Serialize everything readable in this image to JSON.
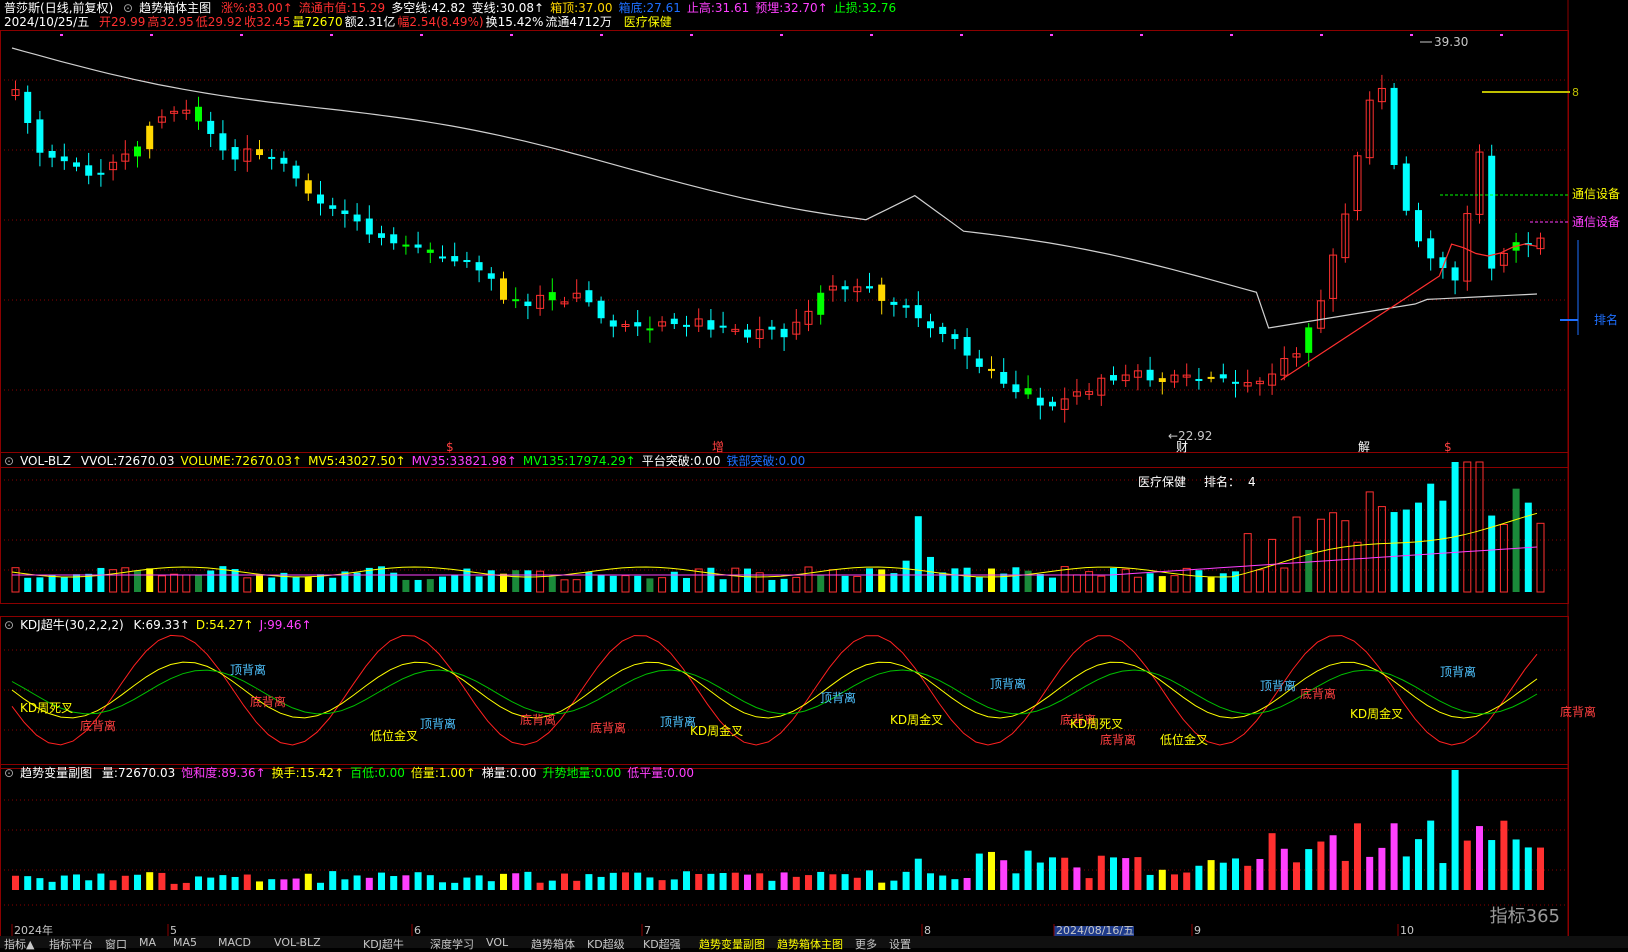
{
  "header": {
    "stock_name": "普莎斯",
    "adjust": "(日线,前复权)",
    "indicator": "趋势箱体主图",
    "main_fields": [
      {
        "label": "涨%:",
        "value": "83.00",
        "color": "#ff3030",
        "arrow": "↑"
      },
      {
        "label": "流通市值:",
        "value": "15.29",
        "color": "#ff3030",
        "arrow": ""
      },
      {
        "label": "多空线:",
        "value": "42.82",
        "color": "#ffffff",
        "arrow": ""
      },
      {
        "label": "变线:",
        "value": "30.08",
        "color": "#ffffff",
        "arrow": "↑"
      },
      {
        "label": "箱顶:",
        "value": "37.00",
        "color": "#ffd700",
        "arrow": ""
      },
      {
        "label": "箱底:",
        "value": "27.61",
        "color": "#1e6fff",
        "arrow": ""
      },
      {
        "label": "止高:",
        "value": "31.61",
        "color": "#ff40ff",
        "arrow": ""
      },
      {
        "label": "预埋:",
        "value": "32.70",
        "color": "#ff40ff",
        "arrow": "↑"
      },
      {
        "label": "止损:",
        "value": "32.76",
        "color": "#00ff00",
        "arrow": ""
      }
    ],
    "date": "2024/10/25/五",
    "quote": [
      {
        "label": "开",
        "value": "29.99",
        "color": "#ff3030"
      },
      {
        "label": "高",
        "value": "32.95",
        "color": "#ff3030"
      },
      {
        "label": "低",
        "value": "29.92",
        "color": "#ff3030"
      },
      {
        "label": "收",
        "value": "32.45",
        "color": "#ff3030"
      },
      {
        "label": "量",
        "value": "72670",
        "color": "#ffff00"
      },
      {
        "label": "额",
        "value": "2.31亿",
        "color": "#ffffff"
      },
      {
        "label": "幅",
        "value": "2.54(8.49%)",
        "color": "#ff3030"
      },
      {
        "label": "换",
        "value": "15.42%",
        "color": "#ffffff"
      },
      {
        "label": "流通",
        "value": "4712万",
        "color": "#ffffff"
      }
    ],
    "sector": "医疗保健"
  },
  "price_labels": {
    "high": "39.30",
    "low": "22.92",
    "right1": "通信设备",
    "right2": "通信设备",
    "right3": "排名",
    "right0": "8",
    "markers": [
      "$",
      "增",
      "财",
      "解",
      "$"
    ]
  },
  "vol_panel": {
    "title": "VOL-BLZ",
    "fields": [
      {
        "label": "VVOL:",
        "value": "72670.03",
        "color": "#ffffff"
      },
      {
        "label": "VOLUME:",
        "value": "72670.03",
        "color": "#ffff00",
        "arrow": "↑"
      },
      {
        "label": "MV5:",
        "value": "43027.50",
        "color": "#ffff00",
        "arrow": "↑"
      },
      {
        "label": "MV35:",
        "value": "33821.98",
        "color": "#ff40ff",
        "arrow": "↑"
      },
      {
        "label": "MV135:",
        "value": "17974.29",
        "color": "#00ff00",
        "arrow": "↑"
      },
      {
        "label": "平台突破:",
        "value": "0.00",
        "color": "#ffffff",
        "arrow": ""
      },
      {
        "label": "铁部突破:",
        "value": "0.00",
        "color": "#1e6fff",
        "arrow": ""
      }
    ],
    "sector_label": "医疗保健",
    "rank_label": "排名：",
    "rank_value": "4"
  },
  "kdj_panel": {
    "title": "KDJ超牛(30,2,2,2)",
    "fields": [
      {
        "label": "K:",
        "value": "69.33",
        "color": "#ffffff",
        "arrow": "↑"
      },
      {
        "label": "D:",
        "value": "54.27",
        "color": "#ffff00",
        "arrow": "↑"
      },
      {
        "label": "J:",
        "value": "99.46",
        "color": "#ff40ff",
        "arrow": "↑"
      }
    ],
    "labels": [
      "顶背离",
      "底背离",
      "KD周死叉",
      "低位金叉",
      "KD周金叉"
    ]
  },
  "trend_panel": {
    "title": "趋势变量副图",
    "fields": [
      {
        "label": "量:",
        "value": "72670.03",
        "color": "#ffffff",
        "arrow": ""
      },
      {
        "label": "饱和度:",
        "value": "89.36",
        "color": "#ff40ff",
        "arrow": "↑"
      },
      {
        "label": "换手:",
        "value": "15.42",
        "color": "#ffff00",
        "arrow": "↑"
      },
      {
        "label": "百低:",
        "value": "0.00",
        "color": "#00ff00",
        "arrow": ""
      },
      {
        "label": "倍量:",
        "value": "1.00",
        "color": "#ffff00",
        "arrow": "↑"
      },
      {
        "label": "梯量:",
        "value": "0.00",
        "color": "#ffffff",
        "arrow": ""
      },
      {
        "label": "升势地量:",
        "value": "0.00",
        "color": "#00ff00",
        "arrow": ""
      },
      {
        "label": "低平量:",
        "value": "0.00",
        "color": "#ff40ff",
        "arrow": ""
      }
    ]
  },
  "time_axis": {
    "labels": [
      "2024年",
      "5",
      "6",
      "7",
      "8",
      "2024/08/16/五",
      "9",
      "10"
    ]
  },
  "bottom_tabs": [
    "指标▲",
    "指标平台",
    "窗口",
    "MA",
    "MA5",
    "MACD",
    "VOL-BLZ",
    "KDJ超牛",
    "深度学习",
    "VOL",
    "趋势箱体",
    "KD超级",
    "KD超强",
    "趋势变量副图",
    "趋势箱体主图",
    "更多",
    "设置"
  ],
  "watermark": "指标365",
  "colors": {
    "up": "#ff3030",
    "down": "#00ffff",
    "limit_up": "#ffd700",
    "green": "#00ff00",
    "grid": "#8b0000",
    "ma": "#d0d0d0"
  }
}
